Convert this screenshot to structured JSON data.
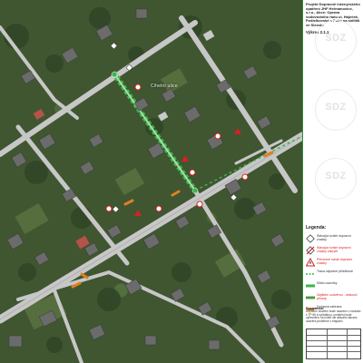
{
  "map": {
    "street_label": "Cihelní ulice"
  },
  "sheet": {
    "title": "Projekt Dopravně inženýrského opatření JHF Heřmanovice, s.r.o., Akce: Oprava vodovodního řadu ul. Háječek, Poštelkovská a Polní na sídlišti ve Slezské",
    "drawing_label": "Výkres 2.1.1",
    "watermark": "SDZ",
    "legend_heading": "Legenda:",
    "legend": [
      {
        "label": "Stávající svislé dopravní značky",
        "color": "#444444",
        "icon": "diamond-sign-icon"
      },
      {
        "label": "Stávající svislé dopravní značky zakryté",
        "color": "#d22222",
        "icon": "covered-sign-icon"
      },
      {
        "label": "Přenosné svislé dopravní značky",
        "color": "#d22222",
        "icon": "warning-sign-icon"
      },
      {
        "label": "Trasa objízdné příležitosti",
        "color": "#3cb44b",
        "icon": "dashed-line-icon"
      },
      {
        "label": "Místo uzavírky",
        "color": "#3cb44b",
        "icon": "closure-icon"
      },
      {
        "label": "Zajištění uzávěrou - obslouží přístup",
        "color": "#d22222",
        "icon": "barrier-line-icon"
      },
      {
        "label": "Dočasná zábrana",
        "color": "#e08020",
        "icon": "fence-icon"
      }
    ],
    "note_heading": "Poznámka:",
    "note_text": "Dopravní značení bude osazeno v souladu s TP 66 a vyhláškou, umístění bude upřesněno na místě dle aktuální situace, uzávěra proběhne v etapách."
  },
  "colors": {
    "road": "#c7c7c7",
    "roof": "#6b6b6b",
    "accent_green": "#3cb44b",
    "accent_red": "#d22222",
    "frame": "#2f8f3c"
  }
}
